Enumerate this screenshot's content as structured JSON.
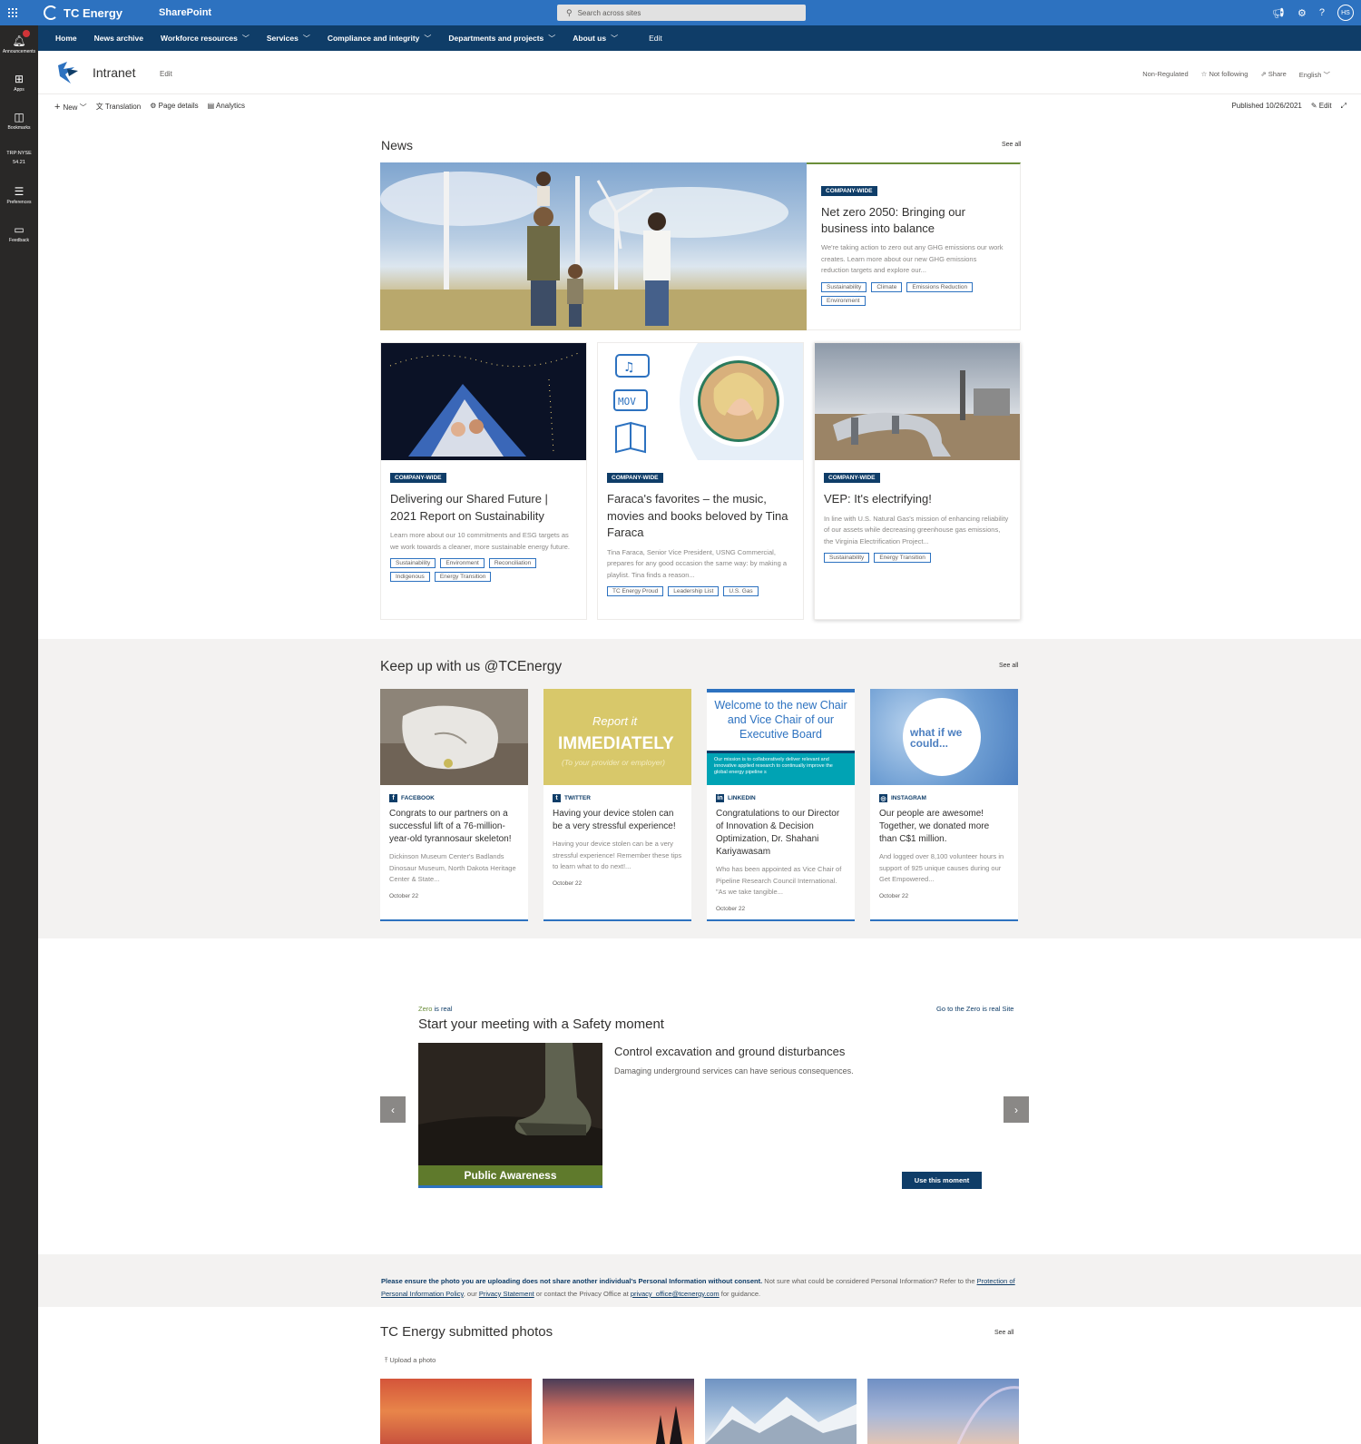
{
  "suite": {
    "brand": "TC Energy",
    "app": "SharePoint",
    "search_placeholder": "Search across sites",
    "avatar_initials": "HS"
  },
  "globalnav": {
    "items": [
      "Home",
      "News archive",
      "Workforce resources",
      "Services",
      "Compliance and integrity",
      "Departments and projects",
      "About us"
    ],
    "edit": "Edit"
  },
  "rail": {
    "announcements": "Announcements",
    "apps": "Apps",
    "bookmarks": "Bookmarks",
    "stock_symbol": "TRP:NYSE",
    "stock_price": "54.21",
    "preferences": "Preferences",
    "feedback": "Feedback"
  },
  "site": {
    "title": "Intranet",
    "edit": "Edit",
    "regulated": "Non-Regulated",
    "following": "Not following",
    "share": "Share",
    "language": "English"
  },
  "cmd": {
    "new": "New",
    "translation": "Translation",
    "page_details": "Page details",
    "analytics": "Analytics",
    "published": "Published 10/26/2021",
    "edit": "Edit"
  },
  "news": {
    "title": "News",
    "see_all": "See all",
    "hero": {
      "badge": "COMPANY-WIDE",
      "title": "Net zero 2050: Bringing our business into balance",
      "desc": "We're taking action to zero out any GHG emissions our work creates. Learn more about our new GHG emissions reduction targets and explore our...",
      "tags": [
        "Sustainability",
        "Climate",
        "Emissions Reduction",
        "Environment"
      ]
    },
    "cards": [
      {
        "badge": "COMPANY-WIDE",
        "title": "Delivering our Shared Future | 2021 Report on Sustainability",
        "desc": "Learn more about our 10 commitments and ESG targets as we work towards a cleaner, more sustainable energy future.",
        "tags": [
          "Sustainability",
          "Environment",
          "Reconciliation",
          "Indigenous",
          "Energy Transition"
        ]
      },
      {
        "badge": "COMPANY-WIDE",
        "title": "Faraca's favorites – the music, movies and books beloved by Tina Faraca",
        "desc": "Tina Faraca, Senior Vice President, USNG Commercial, prepares for any good occasion the same way: by making a playlist. Tina finds a reason...",
        "tags": [
          "TC Energy Proud",
          "Leadership List",
          "U.S. Gas"
        ]
      },
      {
        "badge": "COMPANY-WIDE",
        "title": "VEP: It's electrifying!",
        "desc": "In line with U.S. Natural Gas's mission of enhancing reliability of our assets while decreasing greenhouse gas emissions, the Virginia Electrification Project...",
        "tags": [
          "Sustainability",
          "Energy Transition"
        ]
      }
    ],
    "mov_label": "MOV"
  },
  "social": {
    "title": "Keep up with us @TCEnergy",
    "see_all": "See all",
    "cards": [
      {
        "network": "FACEBOOK",
        "icon": "facebook-icon",
        "title": "Congrats to our partners on a successful lift of a 76-million-year-old tyrannosaur skeleton!",
        "desc": "Dickinson Museum Center's Badlands Dinosaur Museum, North Dakota Heritage Center & State...",
        "date": "October 22"
      },
      {
        "network": "TWITTER",
        "icon": "twitter-icon",
        "title": "Having your device stolen can be a very stressful experience!",
        "desc": "Having your device stolen can be a very stressful experience! Remember these tips to learn what to do next!...",
        "date": "October 22",
        "img_line1": "Report it",
        "img_line2": "IMMEDIATELY",
        "img_line3": "(To your provider or employer)"
      },
      {
        "network": "LINKEDIN",
        "icon": "linkedin-icon",
        "title": "Congratulations to our Director of Innovation & Decision Optimization, Dr. Shahani Kariyawasam",
        "desc": "Who has been appointed as Vice Chair of Pipeline Research Council International. \"As we take tangible...",
        "date": "October 22",
        "img_heading": "Welcome to the new Chair and Vice Chair of our Executive Board",
        "img_mission": "Our mission is to collaboratively deliver relevant and innovative applied research to continually improve the global energy pipeline s"
      },
      {
        "network": "INSTAGRAM",
        "icon": "instagram-icon",
        "title": "Our people are awesome! Together, we donated more than C$1 million.",
        "desc": "And logged over 8,100 volunteer hours in support of 925 unique causes during our Get Empowered...",
        "date": "October 22",
        "img_text": "what if we could..."
      }
    ]
  },
  "safety": {
    "label_zero": "Zero",
    "label_rest": " is real",
    "link": "Go to the Zero is real Site",
    "title": "Start your meeting with a Safety moment",
    "img_caption": "Public Awareness",
    "moment_title": "Control excavation and ground disturbances",
    "moment_desc": "Damaging underground services can have serious consequences.",
    "use_button": "Use this moment"
  },
  "privacy": {
    "bold": "Please ensure the photo you are uploading does not share another individual's Personal Information without consent.",
    "text1": " Not sure what could be considered Personal Information? Refer to the ",
    "link1": "Protection of Personal Information Policy",
    "text2": ", our ",
    "link2": "Privacy Statement",
    "text3": " or contact the Privacy Office at ",
    "link3": "privacy_office@tcenergy.com",
    "text4": " for guidance."
  },
  "photos": {
    "title": "TC Energy submitted photos",
    "see_all": "See all",
    "upload": "Upload a photo"
  },
  "colors": {
    "suite_blue": "#2d72c0",
    "nav_navy": "#0f3d68",
    "rail_dark": "#292827",
    "accent_green": "#6b8e3a"
  }
}
